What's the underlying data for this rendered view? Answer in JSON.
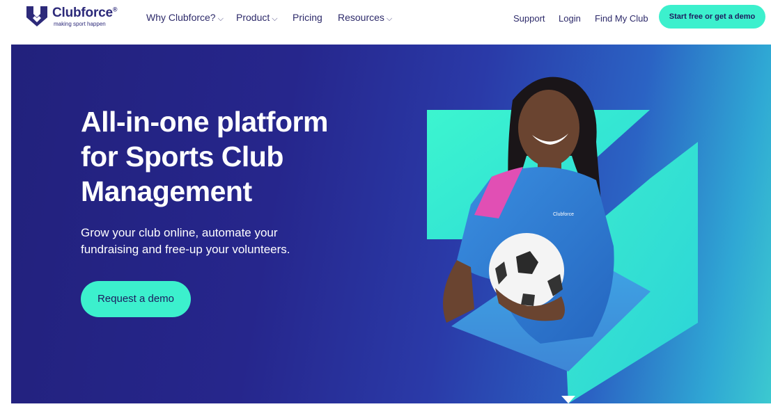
{
  "header": {
    "brand": "Clubforce",
    "registered_mark": "®",
    "tagline": "making sport happen",
    "nav": [
      {
        "label": "Why Clubforce?",
        "has_dropdown": true
      },
      {
        "label": "Product",
        "has_dropdown": true
      },
      {
        "label": "Pricing",
        "has_dropdown": false
      },
      {
        "label": "Resources",
        "has_dropdown": true
      }
    ],
    "right_links": [
      "Support",
      "Login",
      "Find My Club"
    ],
    "cta": "Start free or get a demo"
  },
  "hero": {
    "headline_lines": [
      "All-in-one platform",
      "for Sports Club",
      "Management"
    ],
    "subtitle_lines": [
      "Grow your club online, automate your",
      "fundraising and free-up your volunteers."
    ],
    "cta": "Request a demo",
    "jersey_text": "Clubforce"
  },
  "icons": {
    "logo": "clubforce-shield-logo-icon",
    "dropdown": "chevron-down-icon"
  },
  "colors": {
    "brand_navy": "#2d2a7a",
    "accent_mint": "#3cf0cd",
    "hero_dark": "#22217c",
    "hero_light": "#3cc9d0"
  }
}
